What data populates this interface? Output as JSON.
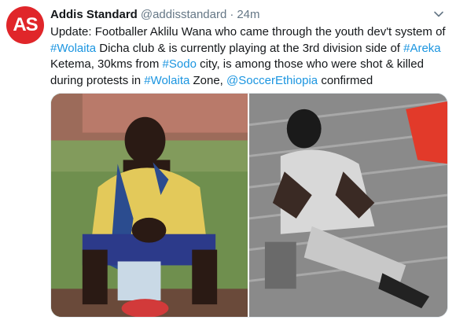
{
  "tweet": {
    "author_name": "Addis Standard",
    "author_handle": "@addisstandard",
    "separator": "·",
    "timestamp": "24m",
    "avatar_text": "AS",
    "text_parts": [
      {
        "text": "Update: Footballer Aklilu Wana who came through the youth dev't system of ",
        "link": false
      },
      {
        "text": "#Wolaita",
        "link": true
      },
      {
        "text": " Dicha club & is currently playing at the 3rd division side of ",
        "link": false
      },
      {
        "text": "#Areka",
        "link": true
      },
      {
        "text": " Ketema, 30kms from ",
        "link": false
      },
      {
        "text": "#Sodo",
        "link": true
      },
      {
        "text": " city, is among those who were shot & killed during protests in ",
        "link": false
      },
      {
        "text": "#Wolaita",
        "link": true
      },
      {
        "text": " Zone, ",
        "link": false
      },
      {
        "text": "@SoccerEthiopia",
        "link": true
      },
      {
        "text": " confirmed",
        "link": false
      }
    ]
  },
  "colors": {
    "link": "#1b95e0",
    "avatar_bg": "#e0262a",
    "muted": "#657786"
  },
  "icons": {
    "menu": "chevron-down-icon"
  }
}
